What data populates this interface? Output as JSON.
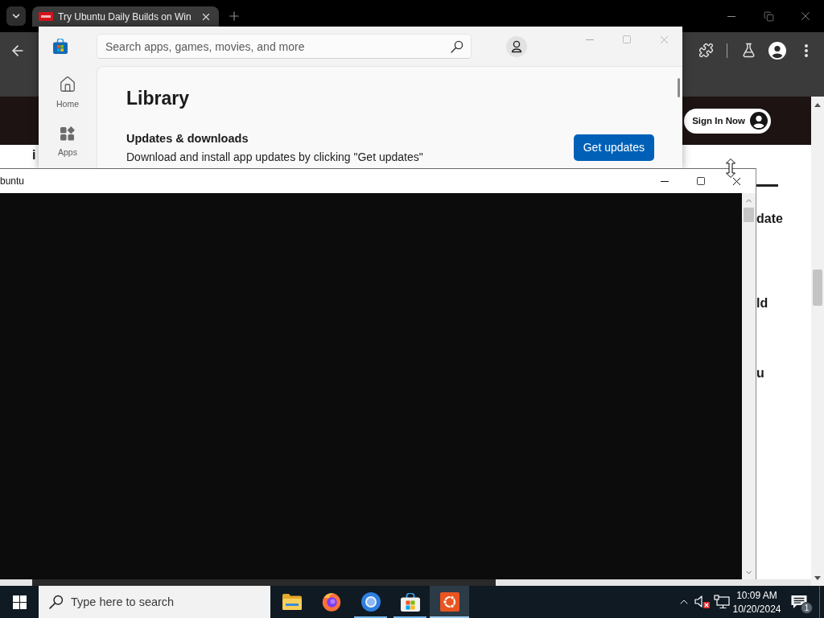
{
  "browser": {
    "tabs": [
      {
        "title": "Try Ubuntu Daily Builds on Win",
        "selected": true
      }
    ]
  },
  "web_page": {
    "sign_in_button": "Sign In Now",
    "left_fragment": "i",
    "right_fragments": [
      "date",
      "ld",
      "u"
    ]
  },
  "store_window": {
    "search": {
      "placeholder": "Search apps, games, movies, and more"
    },
    "nav": [
      {
        "label": "Home",
        "kind": "home",
        "selected": false
      },
      {
        "label": "Apps",
        "kind": "apps",
        "selected": false
      }
    ],
    "heading": "Library",
    "section": {
      "title": "Updates & downloads",
      "text": "Download and install app updates by clicking \"Get updates\"",
      "button": "Get updates"
    }
  },
  "terminal_window": {
    "title": "buntu"
  },
  "taskbar": {
    "search": {
      "placeholder": "Type here to search"
    },
    "apps": [
      {
        "kind": "file-explorer",
        "running": false,
        "active": false
      },
      {
        "kind": "firefox",
        "running": false,
        "active": false
      },
      {
        "kind": "chromium",
        "running": true,
        "active": false
      },
      {
        "kind": "store",
        "running": true,
        "active": false
      },
      {
        "kind": "ubuntu",
        "running": true,
        "active": true
      }
    ],
    "clock": {
      "time": "10:09 AM",
      "date": "10/20/2024"
    },
    "notifications": {
      "count": "1"
    }
  }
}
